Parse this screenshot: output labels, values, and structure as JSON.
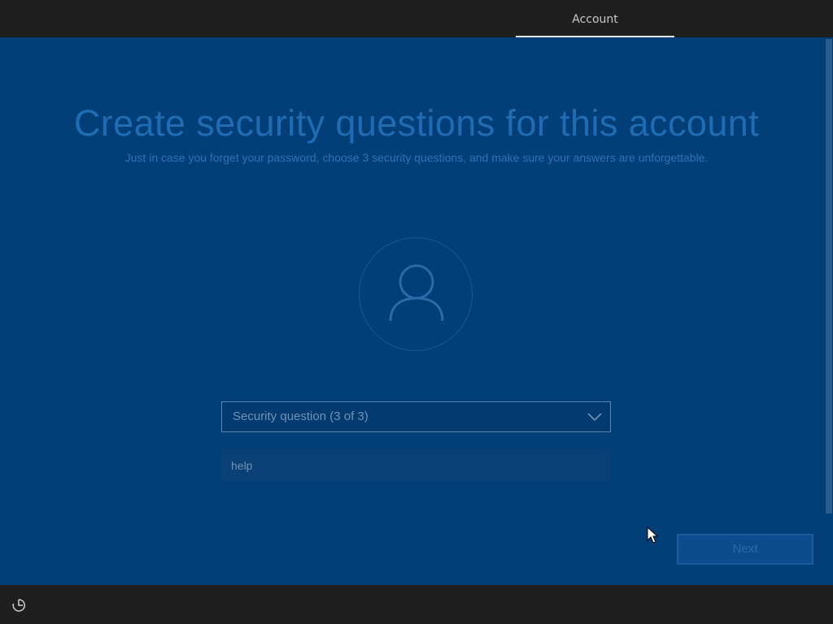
{
  "header": {
    "active_tab_label": "Account"
  },
  "main": {
    "title": "Create security questions for this account",
    "subtitle": "Just in case you forget your password, choose 3 security questions, and make sure your answers are unforgettable.",
    "avatar_icon": "person-icon",
    "security_question_dropdown": {
      "selected_label": "Security question (3 of 3)",
      "chevron_icon": "chevron-down-icon"
    },
    "answer_field": {
      "value": "help"
    },
    "next_button_label": "Next"
  },
  "footer": {
    "accessibility_icon": "accessibility-icon"
  },
  "colors": {
    "page_background": "#023e78",
    "bar_background": "#1f1f1f",
    "title_color": "#1f6cb3"
  }
}
